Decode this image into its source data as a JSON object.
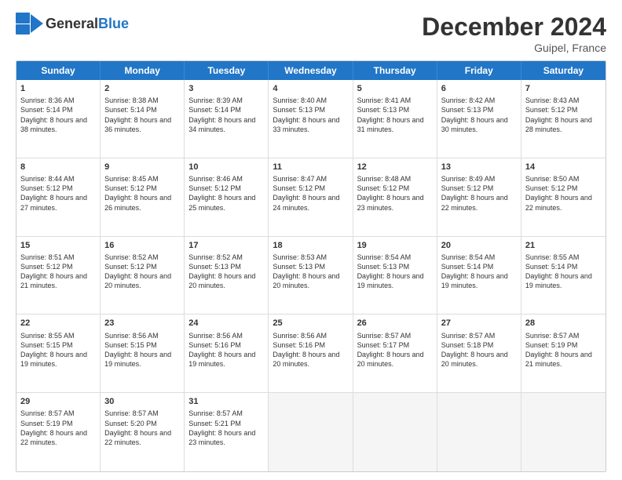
{
  "header": {
    "logo_general": "General",
    "logo_blue": "Blue",
    "month_title": "December 2024",
    "location": "Guipel, France"
  },
  "weekdays": [
    "Sunday",
    "Monday",
    "Tuesday",
    "Wednesday",
    "Thursday",
    "Friday",
    "Saturday"
  ],
  "weeks": [
    [
      {
        "day": "1",
        "sunrise": "8:36 AM",
        "sunset": "5:14 PM",
        "daylight": "8 hours and 38 minutes."
      },
      {
        "day": "2",
        "sunrise": "8:38 AM",
        "sunset": "5:14 PM",
        "daylight": "8 hours and 36 minutes."
      },
      {
        "day": "3",
        "sunrise": "8:39 AM",
        "sunset": "5:14 PM",
        "daylight": "8 hours and 34 minutes."
      },
      {
        "day": "4",
        "sunrise": "8:40 AM",
        "sunset": "5:13 PM",
        "daylight": "8 hours and 33 minutes."
      },
      {
        "day": "5",
        "sunrise": "8:41 AM",
        "sunset": "5:13 PM",
        "daylight": "8 hours and 31 minutes."
      },
      {
        "day": "6",
        "sunrise": "8:42 AM",
        "sunset": "5:13 PM",
        "daylight": "8 hours and 30 minutes."
      },
      {
        "day": "7",
        "sunrise": "8:43 AM",
        "sunset": "5:12 PM",
        "daylight": "8 hours and 28 minutes."
      }
    ],
    [
      {
        "day": "8",
        "sunrise": "8:44 AM",
        "sunset": "5:12 PM",
        "daylight": "8 hours and 27 minutes."
      },
      {
        "day": "9",
        "sunrise": "8:45 AM",
        "sunset": "5:12 PM",
        "daylight": "8 hours and 26 minutes."
      },
      {
        "day": "10",
        "sunrise": "8:46 AM",
        "sunset": "5:12 PM",
        "daylight": "8 hours and 25 minutes."
      },
      {
        "day": "11",
        "sunrise": "8:47 AM",
        "sunset": "5:12 PM",
        "daylight": "8 hours and 24 minutes."
      },
      {
        "day": "12",
        "sunrise": "8:48 AM",
        "sunset": "5:12 PM",
        "daylight": "8 hours and 23 minutes."
      },
      {
        "day": "13",
        "sunrise": "8:49 AM",
        "sunset": "5:12 PM",
        "daylight": "8 hours and 22 minutes."
      },
      {
        "day": "14",
        "sunrise": "8:50 AM",
        "sunset": "5:12 PM",
        "daylight": "8 hours and 22 minutes."
      }
    ],
    [
      {
        "day": "15",
        "sunrise": "8:51 AM",
        "sunset": "5:12 PM",
        "daylight": "8 hours and 21 minutes."
      },
      {
        "day": "16",
        "sunrise": "8:52 AM",
        "sunset": "5:12 PM",
        "daylight": "8 hours and 20 minutes."
      },
      {
        "day": "17",
        "sunrise": "8:52 AM",
        "sunset": "5:13 PM",
        "daylight": "8 hours and 20 minutes."
      },
      {
        "day": "18",
        "sunrise": "8:53 AM",
        "sunset": "5:13 PM",
        "daylight": "8 hours and 20 minutes."
      },
      {
        "day": "19",
        "sunrise": "8:54 AM",
        "sunset": "5:13 PM",
        "daylight": "8 hours and 19 minutes."
      },
      {
        "day": "20",
        "sunrise": "8:54 AM",
        "sunset": "5:14 PM",
        "daylight": "8 hours and 19 minutes."
      },
      {
        "day": "21",
        "sunrise": "8:55 AM",
        "sunset": "5:14 PM",
        "daylight": "8 hours and 19 minutes."
      }
    ],
    [
      {
        "day": "22",
        "sunrise": "8:55 AM",
        "sunset": "5:15 PM",
        "daylight": "8 hours and 19 minutes."
      },
      {
        "day": "23",
        "sunrise": "8:56 AM",
        "sunset": "5:15 PM",
        "daylight": "8 hours and 19 minutes."
      },
      {
        "day": "24",
        "sunrise": "8:56 AM",
        "sunset": "5:16 PM",
        "daylight": "8 hours and 19 minutes."
      },
      {
        "day": "25",
        "sunrise": "8:56 AM",
        "sunset": "5:16 PM",
        "daylight": "8 hours and 20 minutes."
      },
      {
        "day": "26",
        "sunrise": "8:57 AM",
        "sunset": "5:17 PM",
        "daylight": "8 hours and 20 minutes."
      },
      {
        "day": "27",
        "sunrise": "8:57 AM",
        "sunset": "5:18 PM",
        "daylight": "8 hours and 20 minutes."
      },
      {
        "day": "28",
        "sunrise": "8:57 AM",
        "sunset": "5:19 PM",
        "daylight": "8 hours and 21 minutes."
      }
    ],
    [
      {
        "day": "29",
        "sunrise": "8:57 AM",
        "sunset": "5:19 PM",
        "daylight": "8 hours and 22 minutes."
      },
      {
        "day": "30",
        "sunrise": "8:57 AM",
        "sunset": "5:20 PM",
        "daylight": "8 hours and 22 minutes."
      },
      {
        "day": "31",
        "sunrise": "8:57 AM",
        "sunset": "5:21 PM",
        "daylight": "8 hours and 23 minutes."
      },
      null,
      null,
      null,
      null
    ]
  ],
  "labels": {
    "sunrise": "Sunrise:",
    "sunset": "Sunset:",
    "daylight": "Daylight:"
  }
}
